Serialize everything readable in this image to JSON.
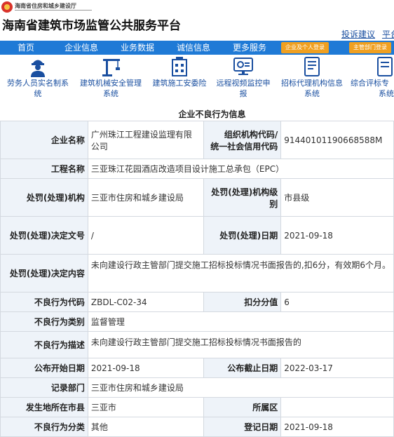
{
  "header": {
    "dept_name": "海南省住房和城乡建设厅",
    "title": "海南省建筑市场监管公共服务平台",
    "links": [
      "投诉建议",
      "平台"
    ]
  },
  "nav": {
    "items": [
      "首页",
      "企业信息",
      "业务数据",
      "诚信信息",
      "更多服务"
    ],
    "login_buttons": [
      "企业及个人登录",
      "主管部门登录"
    ],
    "accent_color": "#1f7ad6",
    "button_color": "#f0a020"
  },
  "services": [
    {
      "label_1": "劳务人员实名制系",
      "label_2": "统",
      "icon": "worker-icon"
    },
    {
      "label_1": "建筑机械安全管理",
      "label_2": "系统",
      "icon": "crane-icon"
    },
    {
      "label_1": "建筑施工安委险",
      "label_2": "",
      "icon": "building-doc-icon"
    },
    {
      "label_1": "远程视频监控申",
      "label_2": "报",
      "icon": "video-monitor-icon"
    },
    {
      "label_1": "招标代理机构信息",
      "label_2": "系统",
      "icon": "document-icon"
    },
    {
      "label_1": "综合评标专",
      "label_2": "系统",
      "icon": "evaluation-icon"
    }
  ],
  "section_title": "企业不良行为信息",
  "record": {
    "company_name_label": "企业名称",
    "company_name": "广州珠江工程建设监理有限公司",
    "org_code_label_1": "组织机构代码/",
    "org_code_label_2": "统一社会信用代码",
    "org_code": "91440101190668588M",
    "project_label": "工程名称",
    "project": "三亚珠江花园酒店改造项目设计施工总承包（EPC）",
    "authority_label": "处罚(处理)机构",
    "authority": "三亚市住房和城乡建设局",
    "authority_level_label": "处罚(处理)机构级别",
    "authority_level": "市县级",
    "doc_no_label": "处罚(处理)决定文号",
    "doc_no": "/",
    "date_label": "处罚(处理)日期",
    "date": "2021-09-18",
    "content_label": "处罚(处理)决定内容",
    "content": "未向建设行政主管部门提交施工招标投标情况书面报告的,扣6分，有效期6个月。",
    "code_label": "不良行为代码",
    "code": "ZBDL-C02-34",
    "score_label": "扣分分值",
    "score": "6",
    "category_label": "不良行为类别",
    "category": "监督管理",
    "description_label": "不良行为描述",
    "description": "未向建设行政主管部门提交施工招标投标情况书面报告的",
    "publish_start_label": "公布开始日期",
    "publish_start": "2021-09-18",
    "publish_end_label": "公布截止日期",
    "publish_end": "2022-03-17",
    "record_dept_label": "记录部门",
    "record_dept": "三亚市住房和城乡建设局",
    "city_label": "发生地所在市县",
    "city": "三亚市",
    "district_label": "所属区",
    "district": "",
    "type_label": "不良行为分类",
    "type": "其他",
    "reg_date_label": "登记日期",
    "reg_date": "2021-09-18"
  }
}
